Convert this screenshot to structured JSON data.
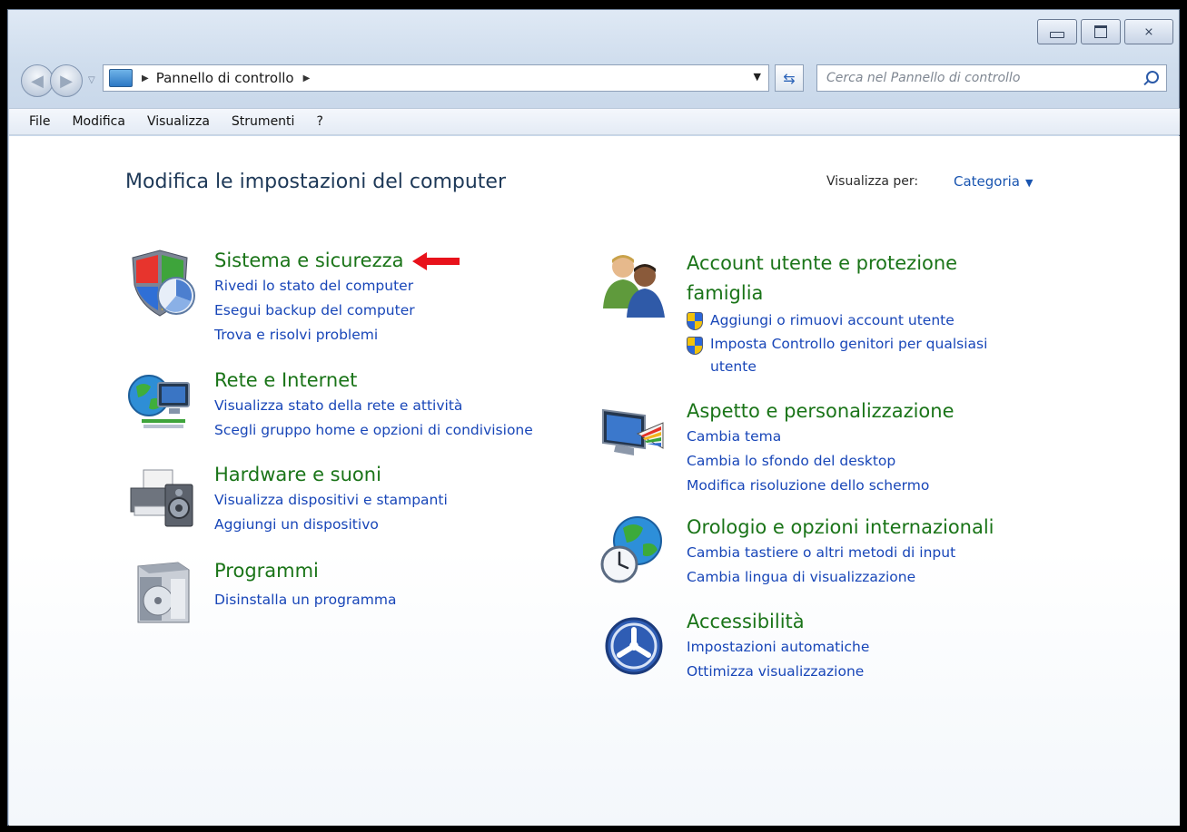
{
  "window": {
    "caption_buttons": {
      "minimize": "",
      "maximize": "",
      "close": "⨯"
    }
  },
  "navbar": {
    "breadcrumb": {
      "label": "Pannello di controllo"
    },
    "search": {
      "placeholder": "Cerca nel Pannello di controllo"
    }
  },
  "menubar": {
    "items": [
      "File",
      "Modifica",
      "Visualizza",
      "Strumenti",
      "?"
    ]
  },
  "content": {
    "title": "Modifica le impostazioni del computer",
    "view_by": {
      "label": "Visualizza per:",
      "value": "Categoria"
    },
    "categories": [
      {
        "title": "Sistema e sicurezza",
        "icon": "shield-icon",
        "links": [
          "Rivedi lo stato del computer",
          "Esegui backup del computer",
          "Trova e risolvi problemi"
        ]
      },
      {
        "title": "Rete e Internet",
        "icon": "network-globe-icon",
        "links": [
          "Visualizza stato della rete e attività",
          "Scegli gruppo home e opzioni di condivisione"
        ]
      },
      {
        "title": "Hardware e suoni",
        "icon": "printer-speaker-icon",
        "links": [
          "Visualizza dispositivi e stampanti",
          "Aggiungi un dispositivo"
        ]
      },
      {
        "title": "Programmi",
        "icon": "programs-box-icon",
        "links": [
          "Disinstalla un programma"
        ]
      },
      {
        "title": "Account utente e protezione famiglia",
        "icon": "users-icon",
        "links": [
          "Aggiungi o rimuovi account utente",
          "Imposta Controllo genitori per qualsiasi utente"
        ]
      },
      {
        "title": "Aspetto e personalizzazione",
        "icon": "monitor-palette-icon",
        "links": [
          "Cambia tema",
          "Cambia lo sfondo del desktop",
          "Modifica risoluzione dello schermo"
        ]
      },
      {
        "title": "Orologio e opzioni internazionali",
        "icon": "globe-clock-icon",
        "links": [
          "Cambia tastiere o altri metodi di input",
          "Cambia lingua di visualizzazione"
        ]
      },
      {
        "title": "Accessibilità",
        "icon": "accessibility-icon",
        "links": [
          "Impostazioni automatiche",
          "Ottimizza visualizzazione"
        ]
      }
    ]
  },
  "colors": {
    "category_title": "#1a7418",
    "link": "#1846b8",
    "annotation_arrow": "#e8121b"
  }
}
